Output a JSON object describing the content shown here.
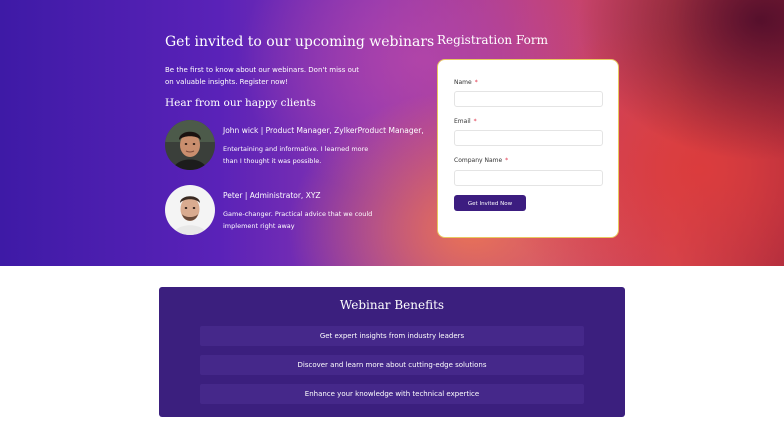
{
  "hero": {
    "headline": "Get invited to our upcoming webinars",
    "intro": "Be the first to know about our webinars. Don't miss out on valuable insights. Register now!",
    "clients_heading": "Hear from our happy clients",
    "testimonials": [
      {
        "name": "John wick | Product Manager, ZylkerProduct Manager,",
        "quote": "Entertaining and informative. I learned more than I thought it was possible."
      },
      {
        "name": "Peter | Administrator, XYZ",
        "quote": "Game-changer. Practical advice that we could implement right away"
      }
    ]
  },
  "form": {
    "title": "Registration Form",
    "fields": [
      {
        "label": "Name",
        "required_mark": "*",
        "value": ""
      },
      {
        "label": "Email",
        "required_mark": "*",
        "value": ""
      },
      {
        "label": "Company Name",
        "required_mark": "*",
        "value": ""
      }
    ],
    "submit_label": "Get Invited Now"
  },
  "benefits": {
    "title": "Webinar Benefits",
    "items": [
      "Get expert insights from industry leaders",
      "Discover and learn more about cutting-edge solutions",
      "Enhance your knowledge with technical expertice"
    ]
  },
  "colors": {
    "accent": "#3c1d80",
    "benefits_bg": "#3b1f7e",
    "required": "#e0344a"
  }
}
